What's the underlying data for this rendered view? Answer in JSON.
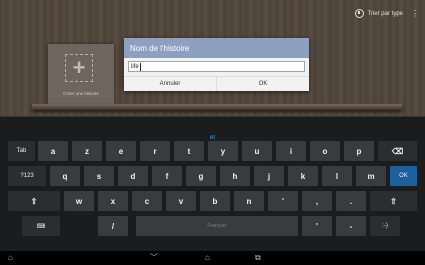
{
  "app": {
    "sort_label": "Trier par type"
  },
  "book": {
    "caption": "Créer une histoire"
  },
  "dialog": {
    "title": "Nom de l'histoire",
    "input_value": "life",
    "cancel_label": "Annuler",
    "ok_label": "OK"
  },
  "keyboard": {
    "suggestion": "et",
    "row1": [
      "Tab",
      "a",
      "z",
      "e",
      "r",
      "t",
      "y",
      "u",
      "i",
      "o",
      "p",
      "⌫"
    ],
    "row2": [
      "?123",
      "q",
      "s",
      "d",
      "f",
      "g",
      "h",
      "j",
      "k",
      "l",
      "m",
      "OK"
    ],
    "row3": [
      "⇧",
      "w",
      "x",
      "c",
      "v",
      "b",
      "n",
      "'",
      ",",
      ".",
      "⇧"
    ],
    "row4": [
      "⌨",
      "/",
      "Français",
      "'",
      "-",
      ":-)"
    ]
  },
  "icons": {
    "clock": "clock-icon",
    "overflow": "overflow-menu-icon",
    "back": "nav-back-icon",
    "home": "nav-home-icon",
    "recents": "nav-recents-icon",
    "hide_keyboard": "nav-hide-keyboard-icon"
  }
}
